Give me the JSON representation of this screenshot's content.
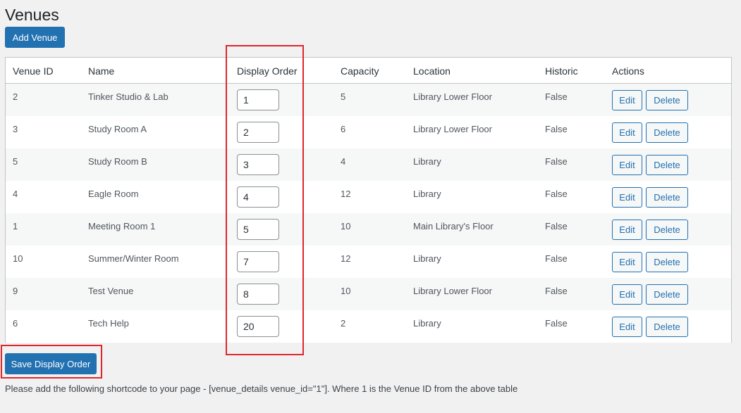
{
  "page": {
    "title": "Venues",
    "add_button_label": "Add Venue",
    "save_button_label": "Save Display Order",
    "shortcode_note": "Please add the following shortcode to your page - [venue_details venue_id=\"1\"]. Where 1 is the Venue ID from the above table"
  },
  "table": {
    "columns": {
      "venue_id": "Venue ID",
      "name": "Name",
      "display_order": "Display Order",
      "capacity": "Capacity",
      "location": "Location",
      "historic": "Historic",
      "actions": "Actions"
    },
    "edit_label": "Edit",
    "delete_label": "Delete",
    "rows": [
      {
        "venue_id": "2",
        "name": "Tinker Studio & Lab",
        "display_order": "1",
        "capacity": "5",
        "location": "Library Lower Floor",
        "historic": "False"
      },
      {
        "venue_id": "3",
        "name": "Study Room A",
        "display_order": "2",
        "capacity": "6",
        "location": "Library Lower Floor",
        "historic": "False"
      },
      {
        "venue_id": "5",
        "name": "Study Room B",
        "display_order": "3",
        "capacity": "4",
        "location": "Library",
        "historic": "False"
      },
      {
        "venue_id": "4",
        "name": "Eagle Room",
        "display_order": "4",
        "capacity": "12",
        "location": "Library",
        "historic": "False"
      },
      {
        "venue_id": "1",
        "name": "Meeting Room 1",
        "display_order": "5",
        "capacity": "10",
        "location": "Main Library's Floor",
        "historic": "False"
      },
      {
        "venue_id": "10",
        "name": "Summer/Winter Room",
        "display_order": "7",
        "capacity": "12",
        "location": "Library",
        "historic": "False"
      },
      {
        "venue_id": "9",
        "name": "Test Venue",
        "display_order": "8",
        "capacity": "10",
        "location": "Library Lower Floor",
        "historic": "False"
      },
      {
        "venue_id": "6",
        "name": "Tech Help",
        "display_order": "20",
        "capacity": "2",
        "location": "Library",
        "historic": "False"
      }
    ]
  },
  "colors": {
    "primary": "#2271b1",
    "highlight": "#e0262d",
    "background": "#f1f1f1"
  }
}
